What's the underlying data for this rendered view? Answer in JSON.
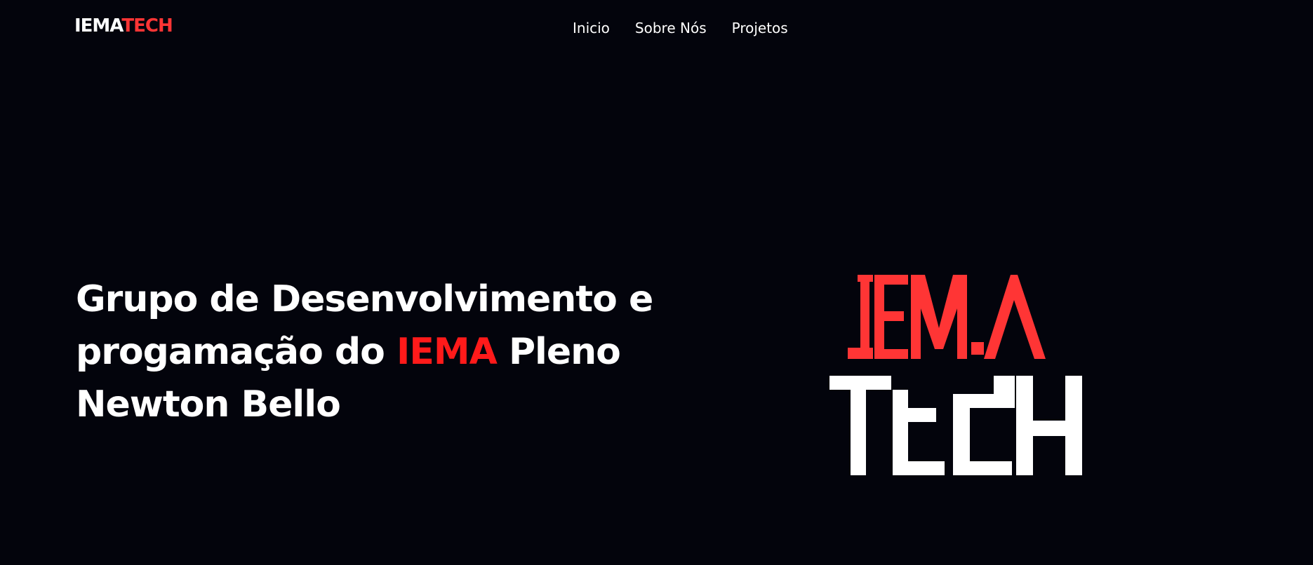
{
  "header": {
    "brand": {
      "part1": "IEMA",
      "part2": "TECH"
    },
    "nav": {
      "items": [
        {
          "label": "Inicio"
        },
        {
          "label": "Sobre Nós"
        },
        {
          "label": "Projetos"
        }
      ]
    }
  },
  "hero": {
    "title_line1": "Grupo de Desenvolvimento e",
    "title_line2_before": "progamação do ",
    "title_accent": "IEMA",
    "title_line2_after": " Pleno",
    "title_line3": "Newton Bello",
    "logo": {
      "top_text": "IEMA",
      "bottom_text": "TECH"
    }
  },
  "colors": {
    "background": "#03040c",
    "accent": "#ff1a1a",
    "logo_red": "#ff3535",
    "text": "#ffffff"
  }
}
